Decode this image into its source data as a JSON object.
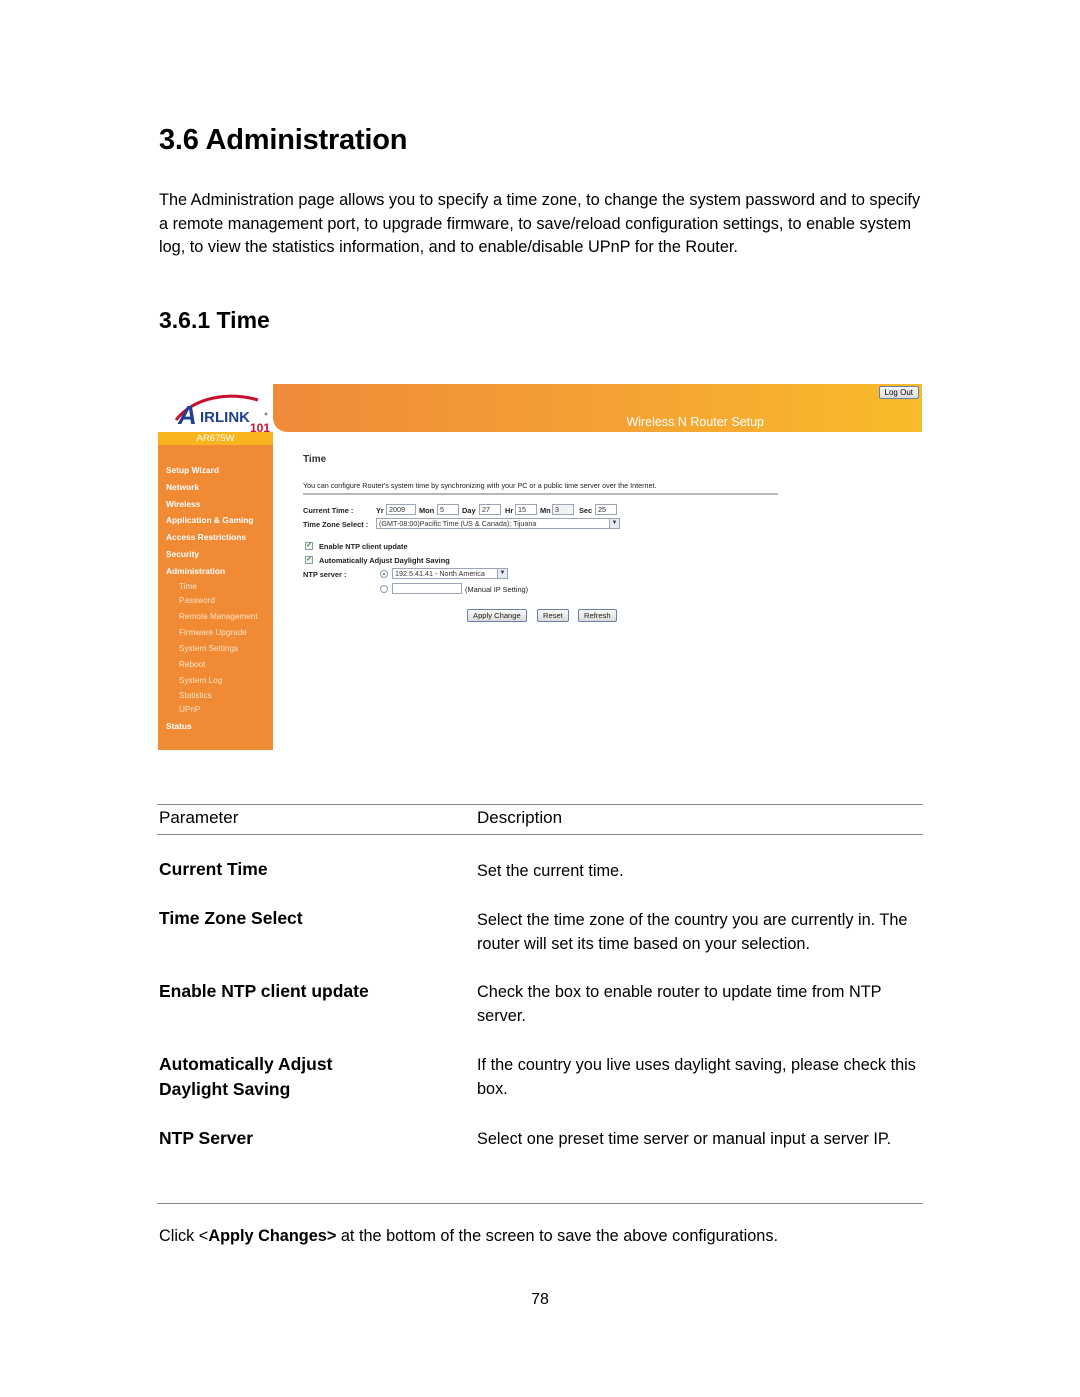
{
  "heading": "3.6 Administration",
  "intro": "The Administration page allows you to specify a time zone, to change the system password and to specify a remote management port, to upgrade firmware, to save/reload configuration settings, to enable system log, to view the statistics information, and to enable/disable UPnP for the Router.",
  "subheading": "3.6.1 Time",
  "router_ui": {
    "logo_text": "AIRLINK 101",
    "model": "AR675W",
    "banner_title": "Wireless N Router Setup",
    "logout_label": "Log Out",
    "sidebar": {
      "items": [
        {
          "label": "Setup Wizard"
        },
        {
          "label": "Network"
        },
        {
          "label": "Wireless"
        },
        {
          "label": "Application & Gaming"
        },
        {
          "label": "Access Restrictions"
        },
        {
          "label": "Security"
        },
        {
          "label": "Administration"
        }
      ],
      "sub_items": [
        {
          "label": "Time"
        },
        {
          "label": "Password"
        },
        {
          "label": "Remote Management"
        },
        {
          "label": "Firmware Upgrade"
        },
        {
          "label": "System Settings"
        },
        {
          "label": "Reboot"
        },
        {
          "label": "System Log"
        },
        {
          "label": "Statistics"
        },
        {
          "label": "UPnP"
        }
      ],
      "status_label": "Status"
    },
    "content": {
      "title": "Time",
      "description": "You can configure Router's system time by synchronizing with your PC or a public time server over the Internet.",
      "current_time_label": "Current Time :",
      "yr_label": "Yr",
      "yr_value": "2009",
      "mon_label": "Mon",
      "mon_value": "5",
      "day_label": "Day",
      "day_value": "27",
      "hr_label": "Hr",
      "hr_value": "15",
      "mn_label": "Mn",
      "mn_value": "3",
      "sec_label": "Sec",
      "sec_value": "25",
      "tz_label": "Time Zone Select :",
      "tz_value": "(GMT-08:00)Pacific Time (US & Canada); Tijuana",
      "ntp_enable_label": "Enable NTP client update",
      "ntp_enable_checked": true,
      "dst_label": "Automatically Adjust Daylight Saving",
      "dst_checked": true,
      "ntp_server_label": "NTP server :",
      "ntp_preset_value": "192.5.41.41 - North America",
      "ntp_manual_value": "",
      "ntp_manual_hint": "(Manual IP Setting)",
      "apply_label": "Apply Change",
      "reset_label": "Reset",
      "refresh_label": "Refresh"
    }
  },
  "table": {
    "headers": [
      "Parameter",
      "Description"
    ],
    "rows": [
      {
        "name": "Current Time",
        "desc": "Set the current time."
      },
      {
        "name": "Time Zone Select",
        "desc": "Select the time zone of the country you are currently in. The router will set its time based on your selection."
      },
      {
        "name": "Enable NTP client update",
        "desc": "Check the box to enable router to update time from NTP server."
      },
      {
        "name": "Automatically Adjust Daylight Saving",
        "desc": "If the country you live uses daylight saving, please check this box."
      },
      {
        "name": "NTP Server",
        "desc": "Select one preset time server or manual input a server IP."
      }
    ]
  },
  "footer": {
    "prefix": "Click <",
    "bold": "Apply Changes>",
    "suffix": " at the bottom of the screen to save the above configurations."
  },
  "page_number": "78",
  "colors": {
    "sidebar": "#f08a34",
    "model_bar": "#f9b51c",
    "banner_start": "#f08a3a",
    "banner_end": "#f8bc2a"
  }
}
